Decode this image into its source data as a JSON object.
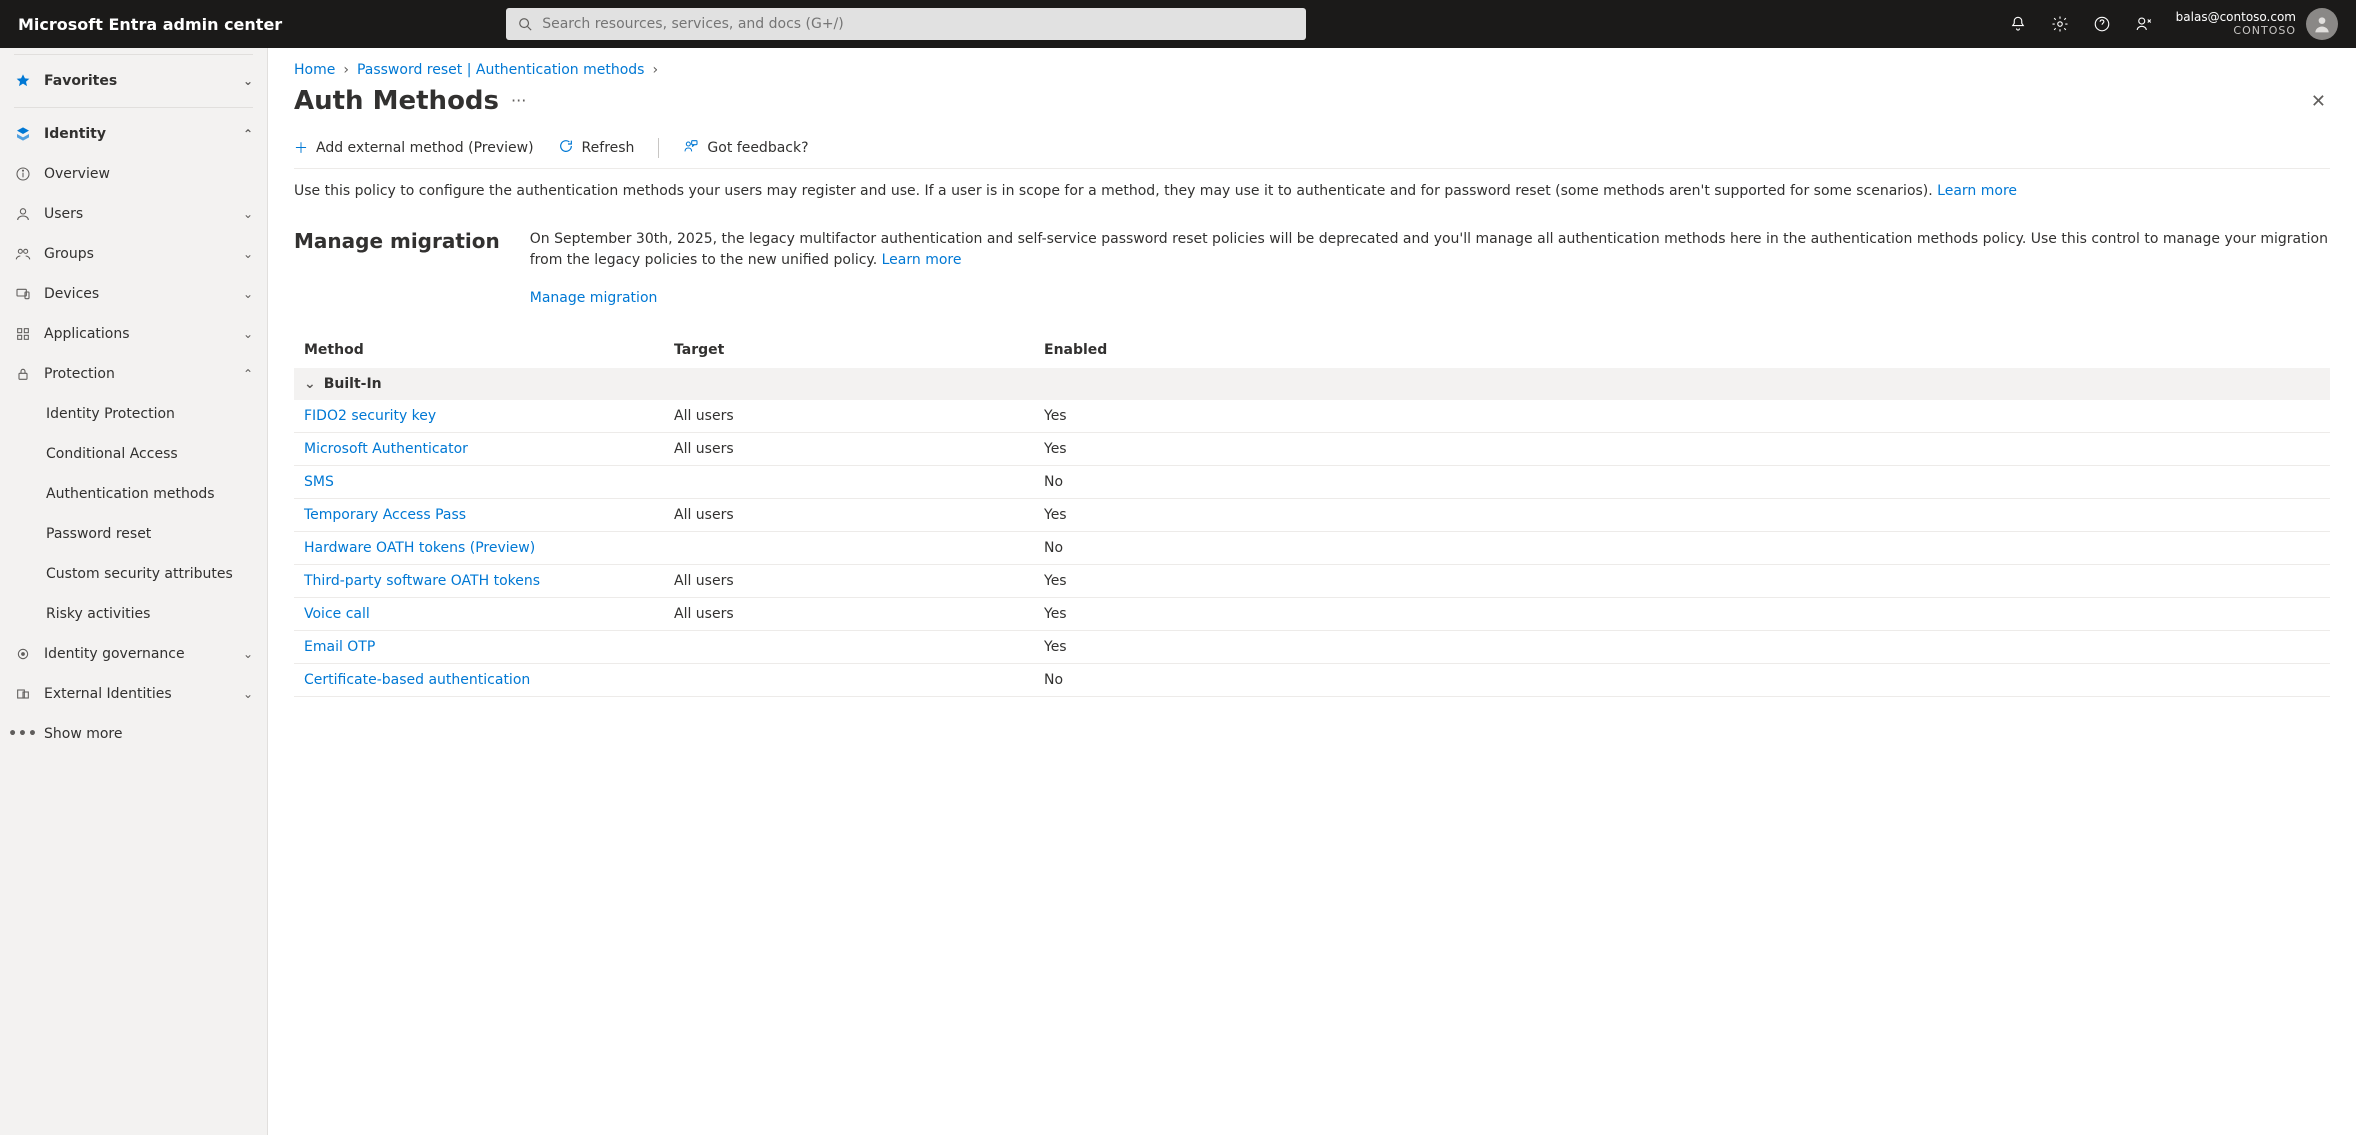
{
  "brand": "Microsoft Entra admin center",
  "search": {
    "placeholder": "Search resources, services, and docs (G+/)"
  },
  "user": {
    "email": "balas@contoso.com",
    "tenant": "CONTOSO"
  },
  "sidebar": {
    "favorites": "Favorites",
    "identity": "Identity",
    "items": {
      "overview": "Overview",
      "users": "Users",
      "groups": "Groups",
      "devices": "Devices",
      "applications": "Applications",
      "protection": "Protection"
    },
    "protection_sub": {
      "idp": "Identity Protection",
      "ca": "Conditional Access",
      "am": "Authentication methods",
      "pr": "Password reset",
      "csa": "Custom security attributes",
      "ra": "Risky activities"
    },
    "idgov": "Identity governance",
    "extid": "External Identities",
    "more": "Show more"
  },
  "breadcrumb": {
    "home": "Home",
    "pr": "Password reset | Authentication methods"
  },
  "page": {
    "title": "Auth Methods"
  },
  "cmd": {
    "add": "Add external method (Preview)",
    "refresh": "Refresh",
    "feedback": "Got feedback?"
  },
  "desc": {
    "text": "Use this policy to configure the authentication methods your users may register and use. If a user is in scope for a method, they may use it to authenticate and for password reset (some methods aren't supported for some scenarios). ",
    "learn": "Learn more"
  },
  "migration": {
    "title": "Manage migration",
    "body": "On September 30th, 2025, the legacy multifactor authentication and self-service password reset policies will be deprecated and you'll manage all authentication methods here in the authentication methods policy. Use this control to manage your migration from the legacy policies to the new unified policy. ",
    "learn": "Learn more",
    "link": "Manage migration"
  },
  "table": {
    "headers": {
      "method": "Method",
      "target": "Target",
      "enabled": "Enabled"
    },
    "group": "Built-In",
    "rows": [
      {
        "method": "FIDO2 security key",
        "target": "All users",
        "enabled": "Yes"
      },
      {
        "method": "Microsoft Authenticator",
        "target": "All users",
        "enabled": "Yes"
      },
      {
        "method": "SMS",
        "target": "",
        "enabled": "No"
      },
      {
        "method": "Temporary Access Pass",
        "target": "All users",
        "enabled": "Yes"
      },
      {
        "method": "Hardware OATH tokens (Preview)",
        "target": "",
        "enabled": "No"
      },
      {
        "method": "Third-party software OATH tokens",
        "target": "All users",
        "enabled": "Yes"
      },
      {
        "method": "Voice call",
        "target": "All users",
        "enabled": "Yes"
      },
      {
        "method": "Email OTP",
        "target": "",
        "enabled": "Yes"
      },
      {
        "method": "Certificate-based authentication",
        "target": "",
        "enabled": "No"
      }
    ]
  }
}
